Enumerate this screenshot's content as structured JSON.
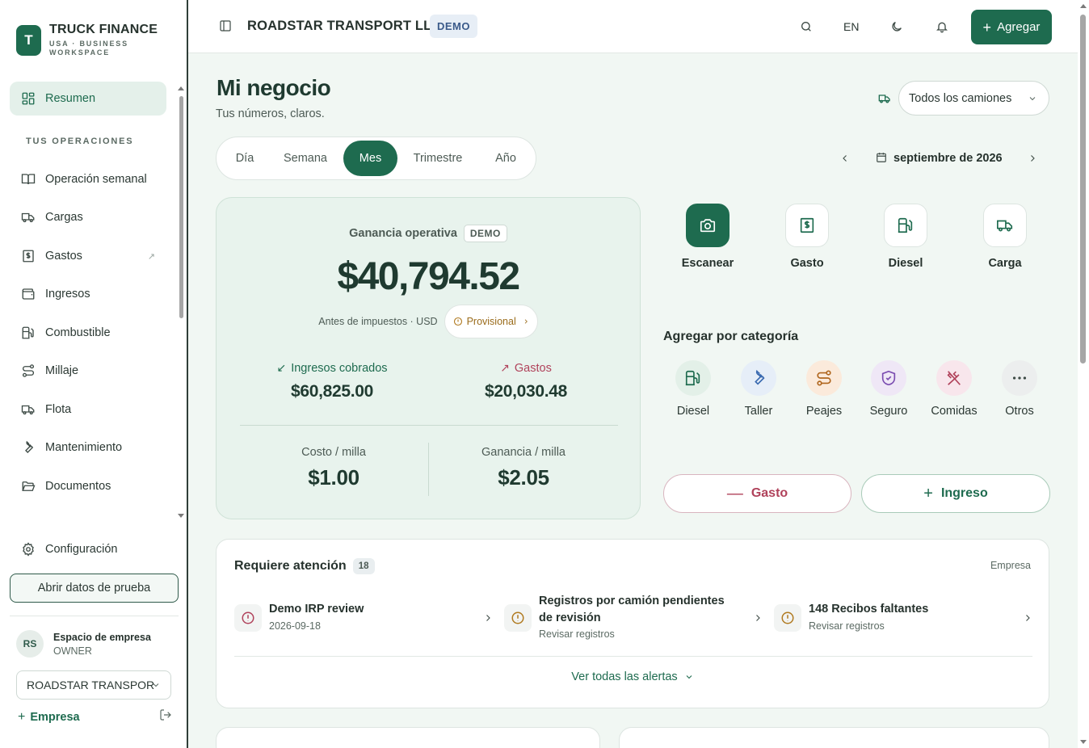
{
  "brand": {
    "logo_letter": "T",
    "name": "TRUCK FINANCE",
    "subtitle": "USA · BUSINESS WORKSPACE"
  },
  "sidebar": {
    "active_item": {
      "label": "Resumen",
      "icon": "grid-icon"
    },
    "section_label": "TUS OPERACIONES",
    "items": [
      {
        "label": "Operación semanal",
        "icon": "book-icon"
      },
      {
        "label": "Cargas",
        "icon": "truck-icon"
      },
      {
        "label": "Gastos",
        "icon": "receipt-icon",
        "external": "↗"
      },
      {
        "label": "Ingresos",
        "icon": "wallet-icon"
      },
      {
        "label": "Combustible",
        "icon": "fuel-icon"
      },
      {
        "label": "Millaje",
        "icon": "route-icon"
      },
      {
        "label": "Flota",
        "icon": "truck-icon"
      },
      {
        "label": "Mantenimiento",
        "icon": "wrench-icon"
      },
      {
        "label": "Documentos",
        "icon": "folder-icon"
      }
    ],
    "settings_label": "Configuración",
    "demo_button": "Abrir datos de prueba",
    "workspace": {
      "initials": "RS",
      "title": "Espacio de empresa",
      "role": "OWNER"
    },
    "company_select": "ROADSTAR TRANSPOR",
    "add_company": "Empresa"
  },
  "topbar": {
    "company": "ROADSTAR TRANSPORT LLC",
    "demo_badge": "DEMO",
    "language": "EN",
    "add_button": "Agregar"
  },
  "page": {
    "title": "Mi negocio",
    "subtitle": "Tus números, claros.",
    "truck_filter": "Todos los camiones",
    "period_tabs": [
      "Día",
      "Semana",
      "Mes",
      "Trimestre",
      "Año"
    ],
    "active_period": "Mes",
    "date_label": "septiembre de 2026"
  },
  "profit": {
    "label": "Ganancia operativa",
    "demo_badge": "DEMO",
    "amount": "$40,794.52",
    "note": "Antes de impuestos · USD",
    "status": "Provisional",
    "income_label": "Ingresos cobrados",
    "income_value": "$60,825.00",
    "expense_label": "Gastos",
    "expense_value": "$20,030.48",
    "cost_per_mile_label": "Costo / milla",
    "cost_per_mile_value": "$1.00",
    "profit_per_mile_label": "Ganancia / milla",
    "profit_per_mile_value": "$2.05"
  },
  "quick_actions": [
    {
      "label": "Escanear",
      "icon": "camera-icon"
    },
    {
      "label": "Gasto",
      "icon": "receipt-icon"
    },
    {
      "label": "Diesel",
      "icon": "fuel-icon"
    },
    {
      "label": "Carga",
      "icon": "truck-icon"
    }
  ],
  "categories": {
    "title": "Agregar por categoría",
    "items": [
      {
        "label": "Diesel",
        "icon": "fuel-icon",
        "bg": "#e3f0e8",
        "fg": "#1e6b4f"
      },
      {
        "label": "Taller",
        "icon": "wrench-icon",
        "bg": "#e6eef8",
        "fg": "#3a6ab0"
      },
      {
        "label": "Peajes",
        "icon": "route-icon",
        "bg": "#fbeadb",
        "fg": "#b0661e"
      },
      {
        "label": "Seguro",
        "icon": "shield-icon",
        "bg": "#efe7f6",
        "fg": "#7a4bb0"
      },
      {
        "label": "Comidas",
        "icon": "utensils-icon",
        "bg": "#f8e6ec",
        "fg": "#b0425b"
      },
      {
        "label": "Otros",
        "icon": "more-icon",
        "bg": "#eceeee",
        "fg": "#3d4a45"
      }
    ]
  },
  "buttons": {
    "expense": "Gasto",
    "income": "Ingreso"
  },
  "attention": {
    "title": "Requiere atención",
    "count": "18",
    "scope": "Empresa",
    "alerts": [
      {
        "title": "Demo IRP review",
        "sub": "2026-09-18",
        "severity": "danger"
      },
      {
        "title": "Registros por camión pendientes de revisión",
        "sub": "Revisar registros",
        "severity": "warning"
      },
      {
        "title": "148 Recibos faltantes",
        "sub": "Revisar registros",
        "severity": "warning"
      }
    ],
    "see_all": "Ver todas las alertas"
  },
  "colors": {
    "brand": "#1e6b4f",
    "danger": "#b0425b",
    "warning": "#b07a20",
    "card_bg": "#e8f3ed"
  }
}
